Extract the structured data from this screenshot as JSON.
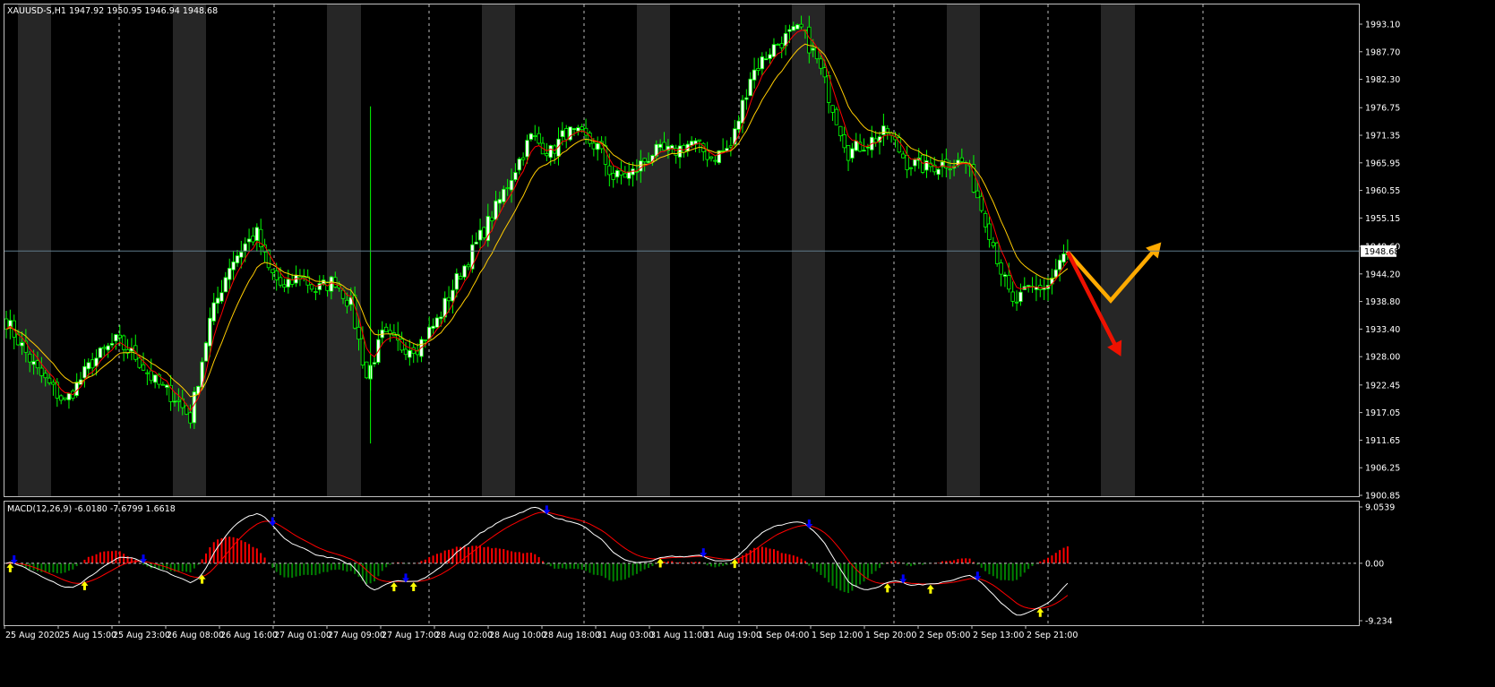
{
  "window": {
    "symbol_header": "XAUUSD-S,H1  1947.92 1950.95 1946.94 1948.68"
  },
  "main_panel": {
    "price_axis_labels": [
      "1993.10",
      "1987.70",
      "1982.30",
      "1976.75",
      "1971.35",
      "1965.95",
      "1960.55",
      "1955.15",
      "1949.60",
      "1944.20",
      "1938.80",
      "1933.40",
      "1928.00",
      "1922.45",
      "1917.05",
      "1911.65",
      "1906.25",
      "1900.85"
    ],
    "price_axis_range": [
      1900.85,
      1993.1
    ],
    "current_price_label": "1948.68",
    "current_price": 1948.68,
    "colors": {
      "bull_body": "#ffffff",
      "bear_body": "#00ff00",
      "wick": "#00ff00",
      "fast_ma": "#ff0000",
      "slow_ma": "#ffcc00",
      "grid": "#ffffff",
      "session_band": "#262626",
      "price_line": "#5f7a8a"
    }
  },
  "macd_panel": {
    "header": "MACD(12,26,9) -6.0180 -7.6799 1.6618",
    "axis_labels": [
      "9.0539",
      "0.00",
      "-9.234"
    ],
    "axis_range": [
      -9.234,
      9.0539
    ],
    "colors": {
      "hist_pos": "#ff0000",
      "hist_neg": "#008000",
      "macd_line": "#ffffff",
      "signal_line": "#ff0000",
      "up_arrow": "#ffff00",
      "down_arrow": "#0000ff"
    }
  },
  "time_axis_labels": [
    "25 Aug 2020",
    "25 Aug 15:00",
    "25 Aug 23:00",
    "26 Aug 08:00",
    "26 Aug 16:00",
    "27 Aug 01:00",
    "27 Aug 09:00",
    "27 Aug 17:00",
    "28 Aug 02:00",
    "28 Aug 10:00",
    "28 Aug 18:00",
    "31 Aug 03:00",
    "31 Aug 11:00",
    "31 Aug 19:00",
    "1 Sep 04:00",
    "1 Sep 12:00",
    "1 Sep 20:00",
    "2 Sep 05:00",
    "2 Sep 13:00",
    "2 Sep 21:00"
  ],
  "chart_data": {
    "type": "candlestick",
    "symbol": "XAUUSD-S",
    "timeframe": "H1",
    "last_bar": {
      "open": 1947.92,
      "high": 1950.95,
      "low": 1946.94,
      "close": 1948.68
    },
    "close_anchors": [
      [
        0,
        1935
      ],
      [
        8,
        1925
      ],
      [
        15,
        1919
      ],
      [
        22,
        1927
      ],
      [
        28,
        1931
      ],
      [
        33,
        1928
      ],
      [
        38,
        1923
      ],
      [
        43,
        1920
      ],
      [
        47,
        1916
      ],
      [
        52,
        1935
      ],
      [
        57,
        1946
      ],
      [
        61,
        1950
      ],
      [
        64,
        1952
      ],
      [
        67,
        1945
      ],
      [
        71,
        1941
      ],
      [
        75,
        1944
      ],
      [
        79,
        1941
      ],
      [
        84,
        1943
      ],
      [
        88,
        1938
      ],
      [
        92,
        1924
      ],
      [
        96,
        1932
      ],
      [
        101,
        1930
      ],
      [
        105,
        1930
      ],
      [
        110,
        1935
      ],
      [
        115,
        1943
      ],
      [
        120,
        1950
      ],
      [
        125,
        1957
      ],
      [
        130,
        1965
      ],
      [
        134,
        1971
      ],
      [
        139,
        1968
      ],
      [
        143,
        1972
      ],
      [
        147,
        1971
      ],
      [
        151,
        1969
      ],
      [
        155,
        1963
      ],
      [
        160,
        1964
      ],
      [
        165,
        1968
      ],
      [
        170,
        1968
      ],
      [
        175,
        1970
      ],
      [
        180,
        1967
      ],
      [
        185,
        1969
      ],
      [
        190,
        1983
      ],
      [
        195,
        1988
      ],
      [
        200,
        1991
      ],
      [
        203,
        1992
      ],
      [
        207,
        1986
      ],
      [
        211,
        1977
      ],
      [
        215,
        1968
      ],
      [
        220,
        1970
      ],
      [
        225,
        1972
      ],
      [
        230,
        1966
      ],
      [
        235,
        1965
      ],
      [
        240,
        1966
      ],
      [
        245,
        1966
      ],
      [
        250,
        1955
      ],
      [
        254,
        1945
      ],
      [
        257,
        1938
      ],
      [
        261,
        1941
      ],
      [
        266,
        1942
      ],
      [
        271,
        1949
      ]
    ],
    "fast_ma_period": 5,
    "slow_ma_period": 12,
    "macd": {
      "fast": 12,
      "slow": 26,
      "signal": 9,
      "main": -6.018,
      "signal_value": -7.6799,
      "histogram": 1.6618
    },
    "projection_arrows": [
      {
        "color": "#ffaa00",
        "path": [
          [
            1948.5,
            271
          ],
          [
            1939,
            282
          ],
          [
            1949.6,
            294
          ]
        ]
      },
      {
        "color": "#ee1100",
        "path": [
          [
            1948.5,
            271
          ],
          [
            1929,
            284
          ]
        ]
      }
    ]
  }
}
